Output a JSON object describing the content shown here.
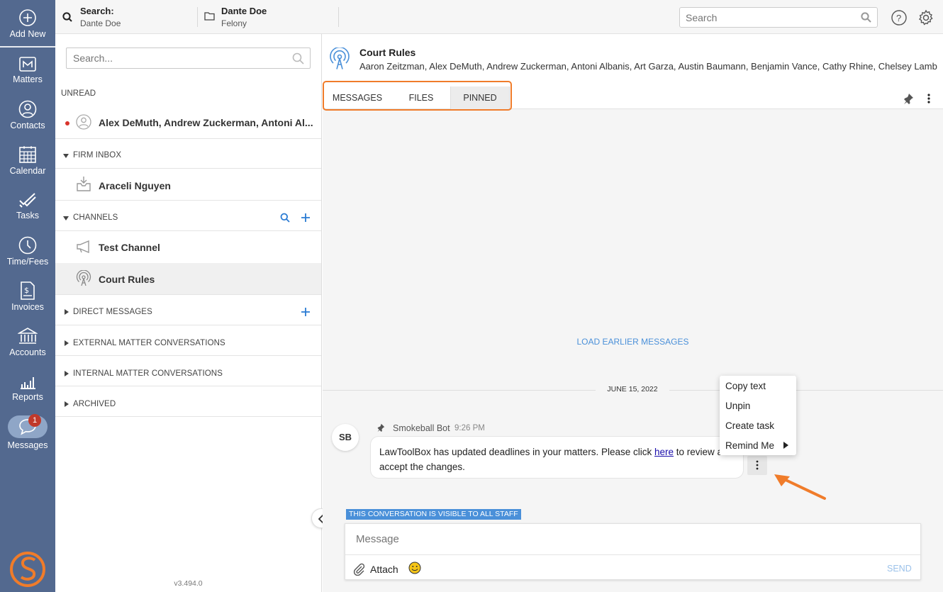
{
  "nav": {
    "add_new": "Add New",
    "items": [
      {
        "label": "Matters",
        "icon": "matters-icon"
      },
      {
        "label": "Contacts",
        "icon": "contacts-icon"
      },
      {
        "label": "Calendar",
        "icon": "calendar-icon"
      },
      {
        "label": "Tasks",
        "icon": "tasks-icon"
      },
      {
        "label": "Time/Fees",
        "icon": "clock-icon"
      },
      {
        "label": "Invoices",
        "icon": "invoice-icon"
      },
      {
        "label": "Accounts",
        "icon": "bank-icon"
      },
      {
        "label": "Reports",
        "icon": "reports-icon"
      },
      {
        "label": "Messages",
        "icon": "chat-icon",
        "badge": "1"
      }
    ],
    "bg_color": "#53698f"
  },
  "topbar": {
    "search_title": "Search:",
    "search_sub": "Dante Doe",
    "matter_title": "Dante Doe",
    "matter_sub": "Felony",
    "global_search_placeholder": "Search"
  },
  "sidebar": {
    "search_placeholder": "Search...",
    "unread_label": "UNREAD",
    "unread_item": "Alex DeMuth, Andrew Zuckerman, Antoni Al...",
    "firm_inbox_label": "FIRM INBOX",
    "firm_inbox_item": "Araceli Nguyen",
    "channels_label": "CHANNELS",
    "channels": [
      "Test Channel",
      "Court Rules"
    ],
    "direct_label": "DIRECT MESSAGES",
    "external_label": "EXTERNAL MATTER CONVERSATIONS",
    "internal_label": "INTERNAL MATTER CONVERSATIONS",
    "archived_label": "ARCHIVED",
    "version": "v3.494.0"
  },
  "conversation": {
    "title": "Court Rules",
    "members": "Aaron Zeitzman, Alex DeMuth, Andrew Zuckerman, Antoni Albanis, Art Garza, Austin Baumann, Benjamin Vance, Cathy Rhine, Chelsey Lambert,...",
    "tabs": [
      "MESSAGES",
      "FILES",
      "PINNED"
    ],
    "active_tab": "PINNED",
    "load_earlier": "LOAD EARLIER MESSAGES",
    "date_divider": "JUNE 15, 2022",
    "message": {
      "avatar": "SB",
      "sender": "Smokeball Bot",
      "time": "9:26 PM",
      "text_before": "LawToolBox has updated deadlines in your matters. Please click ",
      "link": "here",
      "text_after": " to review and accept the changes."
    },
    "context_menu": [
      "Copy text",
      "Unpin",
      "Create task",
      "Remind Me"
    ],
    "visibility_badge": "THIS CONVERSATION IS VISIBLE TO ALL STAFF",
    "composer_placeholder": "Message",
    "attach_label": "Attach",
    "send_label": "SEND",
    "accent_color": "#4a90d9",
    "highlight_color": "#f07c2a"
  }
}
